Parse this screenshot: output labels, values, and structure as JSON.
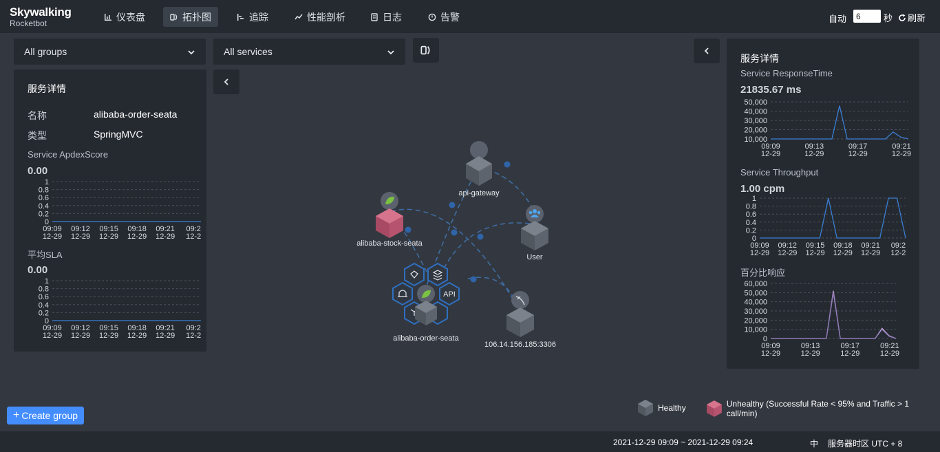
{
  "brand": {
    "name": "Skywalking",
    "product": "Rocketbot"
  },
  "nav": {
    "items": [
      {
        "label": "仪表盘",
        "icon": "bar-chart-icon"
      },
      {
        "label": "拓扑图",
        "icon": "topology-icon",
        "active": true
      },
      {
        "label": "追踪",
        "icon": "trace-icon"
      },
      {
        "label": "性能剖析",
        "icon": "profile-icon"
      },
      {
        "label": "日志",
        "icon": "log-icon"
      },
      {
        "label": "告警",
        "icon": "alarm-icon"
      }
    ],
    "auto_label": "自动",
    "auto_interval": "6",
    "seconds_label": "秒",
    "refresh_label": "刷新"
  },
  "filters": {
    "group": "All groups",
    "service": "All services"
  },
  "left_panel": {
    "title": "服务详情",
    "name_label": "名称",
    "name_value": "alibaba-order-seata",
    "type_label": "类型",
    "type_value": "SpringMVC",
    "apdex_label": "Service ApdexScore",
    "apdex_value": "0.00",
    "sla_label": "平均SLA",
    "sla_value": "0.00"
  },
  "right_panel": {
    "title": "服务详情",
    "response_label": "Service ResponseTime",
    "response_value": "21835.67 ms",
    "throughput_label": "Service Throughput",
    "throughput_value": "1.00 cpm",
    "percentile_label": "百分比响应"
  },
  "chart_data": [
    {
      "id": "apdex",
      "type": "line",
      "x": [
        "09:09\n12-29",
        "09:12\n12-29",
        "09:15\n12-29",
        "09:18\n12-29",
        "09:21\n12-29",
        "09:2\n12-2"
      ],
      "yticks": [
        "1",
        "0.8",
        "0.6",
        "0.4",
        "0.2",
        "0"
      ],
      "ylim": [
        0,
        1
      ],
      "series": [
        {
          "values": [
            0,
            0,
            0,
            0,
            0,
            0,
            0,
            0,
            0,
            0,
            0,
            0,
            0,
            0,
            0,
            0
          ]
        }
      ],
      "color": "#3b7fd6"
    },
    {
      "id": "sla",
      "type": "line",
      "x": [
        "09:09\n12-29",
        "09:12\n12-29",
        "09:15\n12-29",
        "09:18\n12-29",
        "09:21\n12-29",
        "09:2\n12-2"
      ],
      "yticks": [
        "1",
        "0.8",
        "0.6",
        "0.4",
        "0.2",
        "0"
      ],
      "ylim": [
        0,
        1
      ],
      "series": [
        {
          "values": [
            0,
            0,
            0,
            0,
            0,
            0,
            0,
            0,
            0,
            0,
            0,
            0,
            0,
            0,
            0,
            0
          ]
        }
      ],
      "color": "#3b7fd6"
    },
    {
      "id": "response",
      "type": "line",
      "x": [
        "09:09\n12-29",
        "09:13\n12-29",
        "09:17\n12-29",
        "09:21\n12-29"
      ],
      "yticks": [
        "50,000",
        "40,000",
        "30,000",
        "20,000",
        "10,000"
      ],
      "ylim": [
        0,
        58000
      ],
      "series": [
        {
          "values": [
            0,
            0,
            0,
            0,
            0,
            0,
            0,
            0,
            0,
            52000,
            0,
            0,
            0,
            0,
            0,
            0,
            11000,
            3000,
            0
          ]
        }
      ],
      "color": "#3b7fd6"
    },
    {
      "id": "throughput",
      "type": "line",
      "x": [
        "09:09\n12-29",
        "09:12\n12-29",
        "09:15\n12-29",
        "09:18\n12-29",
        "09:21\n12-29",
        "09:2\n12-2"
      ],
      "yticks": [
        "1",
        "0.8",
        "0.6",
        "0.4",
        "0.2",
        "0"
      ],
      "ylim": [
        0,
        1
      ],
      "series": [
        {
          "values": [
            0,
            0,
            0,
            0,
            0,
            0,
            0,
            0,
            1,
            0,
            0,
            0,
            0,
            0,
            0,
            1,
            1,
            0
          ]
        }
      ],
      "color": "#3b7fd6"
    },
    {
      "id": "percentile",
      "type": "line",
      "x": [
        "09:09\n12-29",
        "09:13\n12-29",
        "09:17\n12-29",
        "09:21\n12-29"
      ],
      "yticks": [
        "60,000",
        "50,000",
        "40,000",
        "30,000",
        "20,000",
        "10,000",
        "0"
      ],
      "ylim": [
        0,
        60000
      ],
      "series": [
        {
          "values": [
            0,
            0,
            0,
            0,
            0,
            0,
            0,
            0,
            0,
            52000,
            0,
            0,
            0,
            0,
            0,
            0,
            11000,
            3000,
            0
          ]
        },
        {
          "values": [
            0,
            0,
            0,
            0,
            0,
            0,
            0,
            0,
            0,
            50000,
            0,
            0,
            0,
            0,
            0,
            0,
            10000,
            2500,
            0
          ]
        }
      ],
      "color": "#c9a8d8"
    }
  ],
  "topology": {
    "nodes": [
      {
        "name": "api-gateway",
        "status": "healthy",
        "icon": "gateway-icon"
      },
      {
        "name": "alibaba-stock-seata",
        "status": "unhealthy",
        "icon": "spring-icon"
      },
      {
        "name": "User",
        "status": "healthy",
        "icon": "users-icon"
      },
      {
        "name": "alibaba-order-seata",
        "status": "healthy",
        "icon": "spring-icon"
      },
      {
        "name": "106.14.156.185:3306",
        "status": "healthy",
        "icon": "mysql-icon"
      }
    ]
  },
  "legend": {
    "healthy": "Healthy",
    "unhealthy": "Unhealthy (Successful Rate < 95% and Traffic > 1 call/min)"
  },
  "create_group_label": "Create group",
  "footer": {
    "time_range": "2021-12-29 09:09 ~ 2021-12-29 09:24",
    "lang": "中",
    "timezone": "服务器时区 UTC + 8"
  },
  "colors": {
    "accent": "#448dfe",
    "nav_bg": "#252a31",
    "body_bg": "#333840",
    "unhealthy": "#c0506e",
    "healthy": "#555c67"
  }
}
